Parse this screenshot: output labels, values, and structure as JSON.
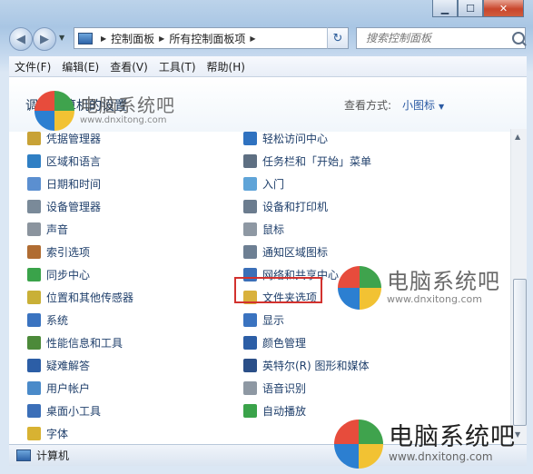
{
  "window": {
    "minimize": "▁",
    "maximize": "☐",
    "close": "✕"
  },
  "address": {
    "crumbs": [
      "控制面板",
      "所有控制面板项"
    ]
  },
  "search": {
    "placeholder": "搜索控制面板"
  },
  "menu": [
    "文件(F)",
    "编辑(E)",
    "查看(V)",
    "工具(T)",
    "帮助(H)"
  ],
  "header": {
    "title": "调整计算机的设置",
    "view_label": "查看方式:",
    "view_value": "小图标"
  },
  "left_items": [
    {
      "label": "凭据管理器",
      "icon": "credential-manager-icon",
      "color": "#c8a236"
    },
    {
      "label": "区域和语言",
      "icon": "globe-icon",
      "color": "#2f7fc4"
    },
    {
      "label": "日期和时间",
      "icon": "calendar-icon",
      "color": "#5b8fd0"
    },
    {
      "label": "设备管理器",
      "icon": "device-manager-icon",
      "color": "#7a8a99"
    },
    {
      "label": "声音",
      "icon": "speaker-icon",
      "color": "#8b949e"
    },
    {
      "label": "索引选项",
      "icon": "index-icon",
      "color": "#b06c32"
    },
    {
      "label": "同步中心",
      "icon": "sync-icon",
      "color": "#3aa34a"
    },
    {
      "label": "位置和其他传感器",
      "icon": "sensor-icon",
      "color": "#c9b037"
    },
    {
      "label": "系统",
      "icon": "system-icon",
      "color": "#3a73c0"
    },
    {
      "label": "性能信息和工具",
      "icon": "performance-icon",
      "color": "#4c8a3a"
    },
    {
      "label": "疑难解答",
      "icon": "troubleshoot-icon",
      "color": "#2c5ea6"
    },
    {
      "label": "用户帐户",
      "icon": "user-accounts-icon",
      "color": "#4a8ac9"
    },
    {
      "label": "桌面小工具",
      "icon": "gadgets-icon",
      "color": "#3b6fb8"
    },
    {
      "label": "字体",
      "icon": "fonts-icon",
      "color": "#d8b232"
    },
    {
      "label": "计算机",
      "icon": "computer-icon",
      "color": "#2d63a8"
    }
  ],
  "right_items": [
    {
      "label": "轻松访问中心",
      "icon": "ease-of-access-icon",
      "color": "#2f72c0"
    },
    {
      "label": "任务栏和「开始」菜单",
      "icon": "taskbar-icon",
      "color": "#5e6f82"
    },
    {
      "label": "入门",
      "icon": "getting-started-icon",
      "color": "#5fa4d8"
    },
    {
      "label": "设备和打印机",
      "icon": "printer-icon",
      "color": "#6b7c8e"
    },
    {
      "label": "鼠标",
      "icon": "mouse-icon",
      "color": "#8e98a3"
    },
    {
      "label": "通知区域图标",
      "icon": "notification-icon",
      "color": "#6d7f93"
    },
    {
      "label": "网络和共享中心",
      "icon": "network-icon",
      "color": "#3b6fb8"
    },
    {
      "label": "文件夹选项",
      "icon": "folder-options-icon",
      "color": "#d9b13c"
    },
    {
      "label": "显示",
      "icon": "display-icon",
      "color": "#3a73c0"
    },
    {
      "label": "颜色管理",
      "icon": "color-management-icon",
      "color": "#2c5ea6"
    },
    {
      "label": "英特尔(R) 图形和媒体",
      "icon": "intel-graphics-icon",
      "color": "#2b4f88"
    },
    {
      "label": "语音识别",
      "icon": "microphone-icon",
      "color": "#8e98a3"
    },
    {
      "label": "自动播放",
      "icon": "autoplay-icon",
      "color": "#3aa34a"
    }
  ],
  "watermarks": [
    {
      "cn": "电脑系统吧",
      "url": "www.dnxitong.com"
    },
    {
      "cn": "电脑系统吧",
      "url": "www.dnxitong.com"
    },
    {
      "cn": "电脑系统吧",
      "url": "www.dnxitong.com"
    }
  ]
}
